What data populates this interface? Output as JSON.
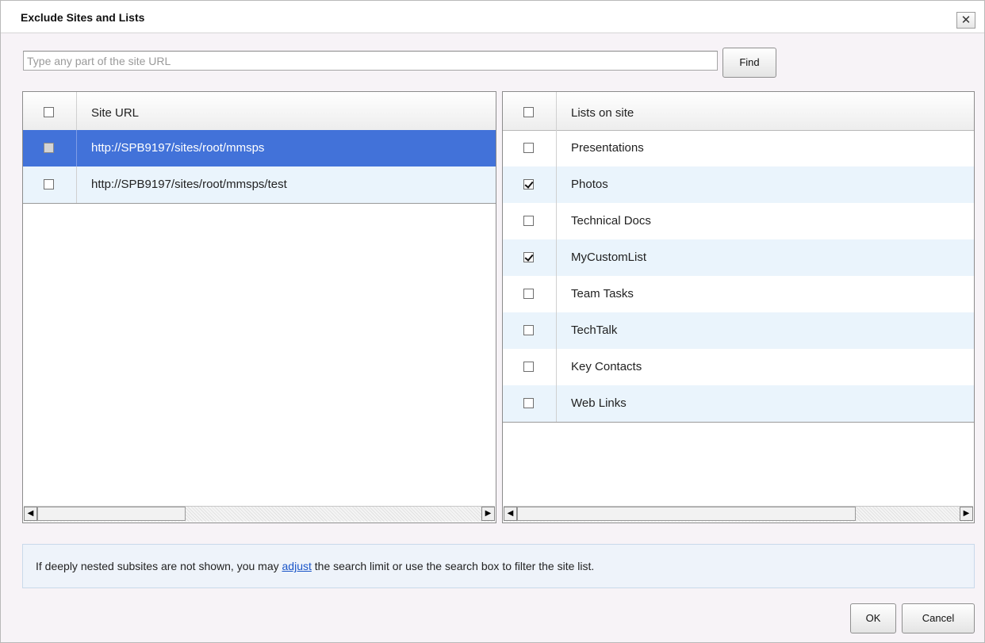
{
  "dialog": {
    "title": "Exclude Sites and Lists",
    "close_label": "✕"
  },
  "search": {
    "placeholder": "Type any part of the site URL",
    "value": "",
    "find_label": "Find"
  },
  "sites_grid": {
    "header": "Site URL",
    "header_checked": false,
    "rows": [
      {
        "url": "http://SPB9197/sites/root/mmsps",
        "checked": false,
        "selected": true
      },
      {
        "url": "http://SPB9197/sites/root/mmsps/test",
        "checked": false,
        "selected": false
      }
    ]
  },
  "lists_grid": {
    "header": "Lists on site",
    "header_checked": false,
    "rows": [
      {
        "name": "Presentations",
        "checked": false
      },
      {
        "name": "Photos",
        "checked": true
      },
      {
        "name": "Technical Docs",
        "checked": false
      },
      {
        "name": "MyCustomList",
        "checked": true
      },
      {
        "name": "Team Tasks",
        "checked": false
      },
      {
        "name": "TechTalk",
        "checked": false
      },
      {
        "name": "Key Contacts",
        "checked": false
      },
      {
        "name": "Web Links",
        "checked": false
      }
    ]
  },
  "scroll_arrows": {
    "left": "◀",
    "right": "▶"
  },
  "info": {
    "before_link": "If deeply nested subsites are not shown, you may ",
    "link_text": "adjust",
    "after_link": " the search limit or use the search box to filter the site list."
  },
  "buttons": {
    "ok_label": "OK",
    "cancel_label": "Cancel"
  },
  "colors": {
    "selected_row": "#4272d9",
    "alt_row": "#eaf4fc",
    "link": "#1a55c8"
  }
}
